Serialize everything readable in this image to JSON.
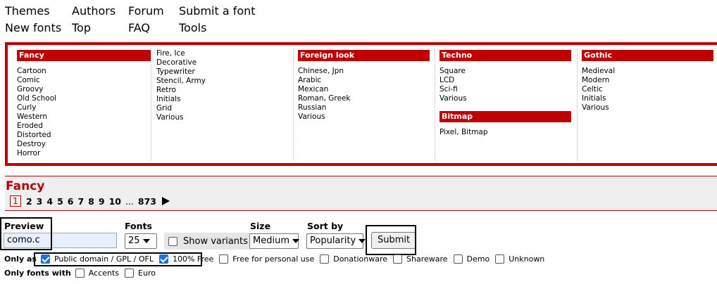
{
  "nav": {
    "col1": [
      "Themes",
      "New fonts"
    ],
    "col2": [
      "Authors",
      "Top"
    ],
    "col3": [
      "Forum",
      "FAQ"
    ],
    "col4": [
      "Submit a font",
      "Tools"
    ]
  },
  "categories": {
    "fancy": {
      "title": "Fancy",
      "items": [
        "Cartoon",
        "Comic",
        "Groovy",
        "Old School",
        "Curly",
        "Western",
        "Eroded",
        "Distorted",
        "Destroy",
        "Horror"
      ]
    },
    "fancy2": {
      "items": [
        "Fire, Ice",
        "Decorative",
        "Typewriter",
        "Stencil, Army",
        "Retro",
        "Initials",
        "Grid",
        "Various"
      ]
    },
    "foreign": {
      "title": "Foreign look",
      "items": [
        "Chinese, Jpn",
        "Arabic",
        "Mexican",
        "Roman, Greek",
        "Russian",
        "Various"
      ]
    },
    "techno": {
      "title": "Techno",
      "items": [
        "Square",
        "LCD",
        "Sci-fi",
        "Various"
      ]
    },
    "bitmap": {
      "title": "Bitmap",
      "items": [
        "Pixel, Bitmap"
      ]
    },
    "gothic": {
      "title": "Gothic",
      "items": [
        "Medieval",
        "Modern",
        "Celtic",
        "Initials",
        "Various"
      ]
    }
  },
  "section": {
    "title": "Fancy",
    "pages": [
      "1",
      "2",
      "3",
      "4",
      "5",
      "6",
      "7",
      "8",
      "9",
      "10"
    ],
    "ellipsis": "...",
    "last_page": "873"
  },
  "form": {
    "preview_label": "Preview",
    "preview_value": "como.c",
    "fonts_label": "Fonts",
    "fonts_value": "25",
    "show_variants": "Show variants",
    "size_label": "Size",
    "size_value": "Medium",
    "sort_label": "Sort by",
    "sort_value": "Popularity",
    "submit": "Submit",
    "only_as_label": "Only as",
    "only_as": [
      {
        "label": "Public domain / GPL / OFL",
        "checked": true
      },
      {
        "label": "100% Free",
        "checked": true
      },
      {
        "label": "Free for personal use",
        "checked": false
      },
      {
        "label": "Donationware",
        "checked": false
      },
      {
        "label": "Shareware",
        "checked": false
      },
      {
        "label": "Demo",
        "checked": false
      },
      {
        "label": "Unknown",
        "checked": false
      }
    ],
    "only_fonts_with_label": "Only fonts with",
    "only_fonts_with": [
      {
        "label": "Accents",
        "checked": false
      },
      {
        "label": "Euro",
        "checked": false
      }
    ]
  },
  "colors": {
    "accent": "#c00000",
    "checkbox": "#1a73e8"
  }
}
